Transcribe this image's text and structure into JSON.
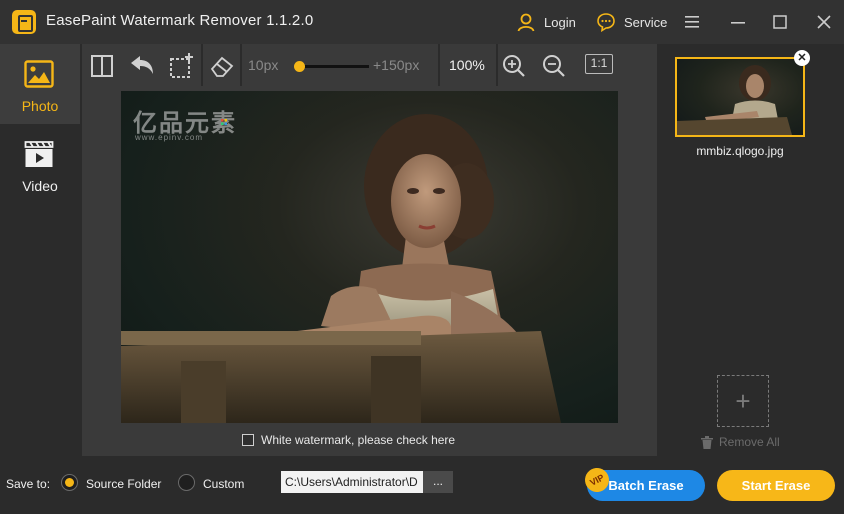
{
  "app": {
    "title": "EasePaint Watermark Remover  1.1.2.0",
    "login_label": "Login",
    "service_label": "Service",
    "accent_color": "#f5b617"
  },
  "sidebar": {
    "items": [
      {
        "label": "Photo",
        "icon": "photo-icon",
        "active": true
      },
      {
        "label": "Video",
        "icon": "video-icon",
        "active": false
      }
    ]
  },
  "toolbar": {
    "tools": [
      "compare-icon",
      "undo-icon",
      "crop-icon",
      "eraser-icon",
      "zoom-in-icon",
      "zoom-out-icon"
    ],
    "brush_min": "10px",
    "brush_max": "+150px",
    "brush_level": 0.0,
    "zoom": "100%",
    "ratio_label": "1:1"
  },
  "canvas": {
    "watermark_text": "亿品元素",
    "watermark_url": "www.epinv.com",
    "white_watermark_label": "White watermark, please check here"
  },
  "files": {
    "thumbnail_name": "mmbiz.qlogo.jpg",
    "add_symbol": "+",
    "remove_all_label": "Remove All"
  },
  "bottom": {
    "save_to_label": "Save to:",
    "source_folder_label": "Source Folder",
    "custom_label": "Custom",
    "path_value": "C:\\Users\\Administrator\\D",
    "browse_label": "...",
    "vip_label": "VIP",
    "batch_erase_label": "Batch Erase",
    "start_erase_label": "Start Erase"
  }
}
